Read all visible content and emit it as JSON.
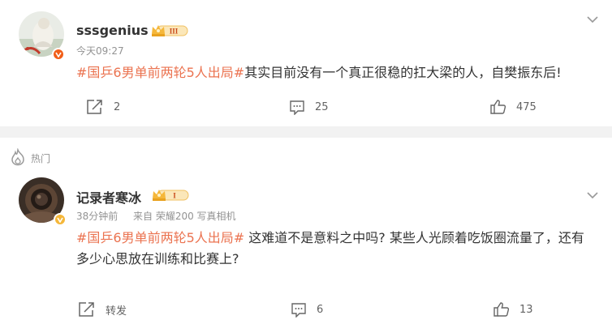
{
  "comments": [
    {
      "username": "sssgenius",
      "level": "III",
      "time": "今天09:27",
      "topic": "#国乒6男单前两轮5人出局#",
      "text": "其实目前没有一个真正很稳的扛大梁的人，自樊振东后!",
      "forward": "2",
      "comments": "25",
      "likes": "475"
    },
    {
      "username": "记录者寒冰",
      "level": "I",
      "time": "38分钟前",
      "source": "来自 荣耀200 写真相机",
      "topic": "#国乒6男单前两轮5人出局#",
      "text": " 这难道不是意料之中吗? 某些人光顾着吃饭圈流量了，还有多少心思放在训练和比赛上?",
      "forward": "转发",
      "comments": "6",
      "likes": "13"
    }
  ],
  "section": {
    "hot_label": "热门"
  },
  "colors": {
    "topic": "#eb7350",
    "gold": "#f5b73a",
    "meta": "#939393",
    "divider": "#f2f2f2"
  }
}
